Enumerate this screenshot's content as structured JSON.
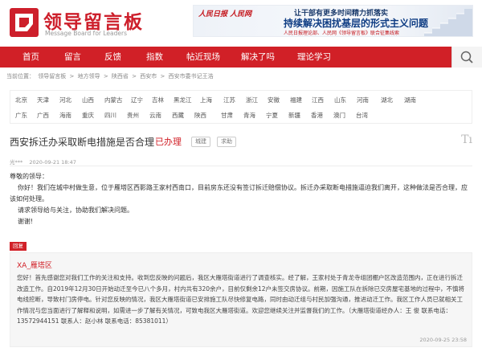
{
  "header": {
    "logo_title": "领导留言板",
    "logo_sub": "Message Board for Leaders",
    "banner": {
      "brand": "人民日报 人民网",
      "line1": "让干部有更多时间精力抓落实",
      "line2": "持续解决困扰基层的形式主义问题",
      "line3": "人民日报理论部、人民网《领导留言板》联合征集线索"
    }
  },
  "nav": {
    "items": [
      "首页",
      "留言",
      "反馈",
      "指数",
      "帖近现场",
      "解决了吗",
      "理论学习"
    ]
  },
  "breadcrumb": {
    "label": "当前位置：",
    "items": [
      "领导留言板",
      "地方领导",
      "陕西省",
      "西安市",
      "西安市委书记王浩"
    ],
    "sep": ">"
  },
  "regions": [
    "北京",
    "天津",
    "河北",
    "山西",
    "内蒙古",
    "辽宁",
    "吉林",
    "黑龙江",
    "上海",
    "江苏",
    "浙江",
    "安徽",
    "福建",
    "江西",
    "山东",
    "河南",
    "湖北",
    "湖南",
    "广东",
    "广西",
    "海南",
    "重庆",
    "四川",
    "贵州",
    "云南",
    "西藏",
    "陕西",
    "甘肃",
    "青海",
    "宁夏",
    "新疆",
    "香港",
    "澳门",
    "台湾"
  ],
  "post": {
    "title": "西安拆迁办采取断电措施是否合理",
    "status": "已办理",
    "tags": [
      "城建",
      "求助"
    ],
    "font_btn": "Tı",
    "author": "光***",
    "time": "2020-09-21 18:47",
    "greeting": "尊敬的领导：",
    "para1": "你好！我们在城中村做生意，位于雁塔区西影路王家村西南口，目前房东还没有签订拆迁赔偿协议。拆迁办采取断电措施逼迫我们离开，这种做法是否合理，应该如何处理。",
    "para2": "请求领导给与关注，协助我们解决问题。",
    "para3": "谢谢!"
  },
  "reply": {
    "badge": "回复",
    "from": "XA_雁塔区",
    "text": "您好！首先感谢您对我们工作的关注和支持。收到您反映的问题后，我区大雁塔街道进行了调查核实。经了解，王家村处于青龙寺组团棚户区改造范围内，正在进行拆迁改造工作。自2019年12月30日开始动迁至今已八个多月，村内共有320余户，目前仅剩余12户未签交房协议。前期，因施工队在拆除已交房屋宅基地的过程中，不慎将电线挖断，导致村门房停电。针对您反映的情况，我区大雁塔街道已安排施工队尽快修复电路，同时由动迁组与村民加强沟通，推进动迁工作。我区工作人员已就相关工作情况与您当面进行了解释和说明，如需进一步了解有关情况，可致电我区大雁塔街道。欢迎您继续关注并监督我们的工作。（大雁塔街道经办人：王 俊 联系电话：13572944151 联系人：赵小林 联系电话：85381011）",
    "time": "2020-09-25 23:58"
  },
  "colors": {
    "brand_red": "#d12027",
    "nav_text": "#ffffff",
    "reply_bg": "#f6f6f6"
  }
}
